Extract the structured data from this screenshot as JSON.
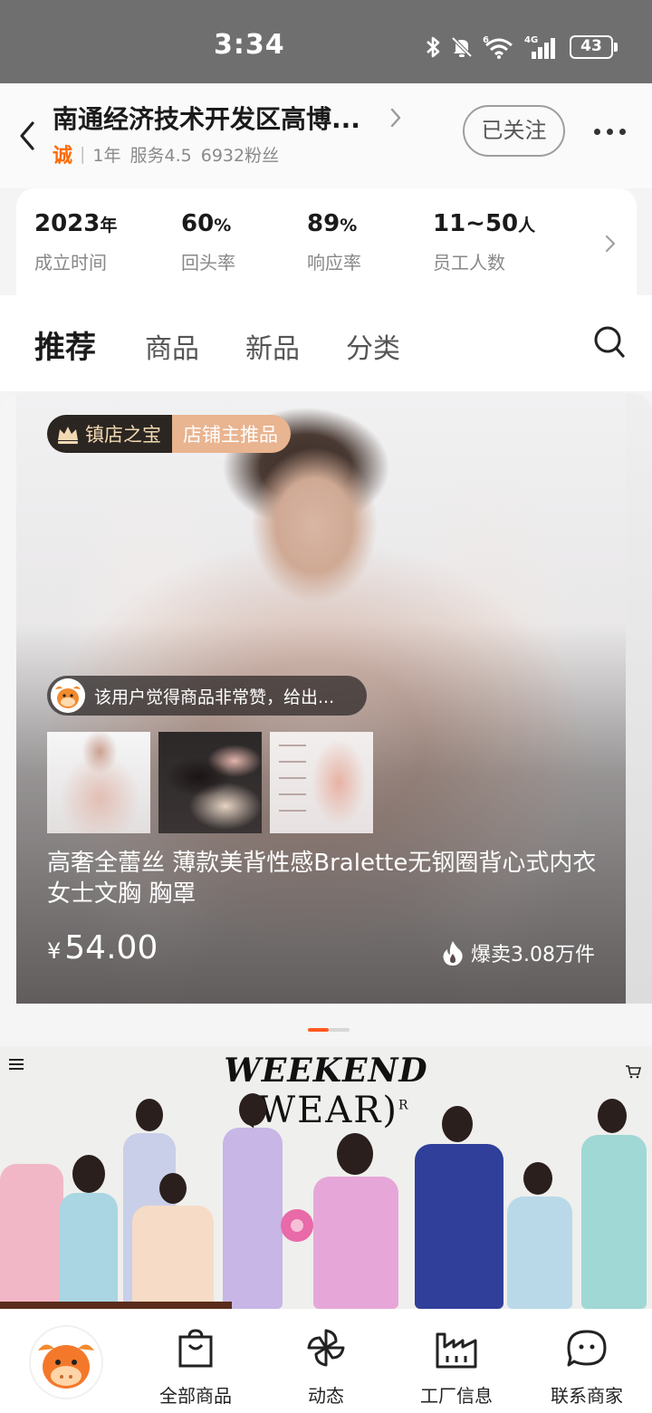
{
  "status_bar": {
    "time": "3:34",
    "battery": "43",
    "network": "4G"
  },
  "shop": {
    "name": "南通经济技术开发区高博...",
    "badge_icon_text": "诚",
    "years": "1年",
    "service": "服务4.5",
    "fans": "6932粉丝",
    "follow_label": "已关注"
  },
  "stats": [
    {
      "value": "2023",
      "unit": "年",
      "label": "成立时间"
    },
    {
      "value": "60",
      "unit": "%",
      "label": "回头率"
    },
    {
      "value": "89",
      "unit": "%",
      "label": "响应率"
    },
    {
      "value": "11~50",
      "unit": "人",
      "label": "员工人数"
    }
  ],
  "tabs": [
    {
      "label": "推荐",
      "active": true
    },
    {
      "label": "商品",
      "active": false
    },
    {
      "label": "新品",
      "active": false
    },
    {
      "label": "分类",
      "active": false
    }
  ],
  "featured": {
    "badge_left": "镇店之宝",
    "badge_right": "店铺主推品",
    "review": "该用户觉得商品非常赞，给出...",
    "title": "高奢全蕾丝 薄款美背性感Bralette无钢圈背心式内衣女士文胸 胸罩",
    "price_symbol": "¥",
    "price": "54.00",
    "sales": "爆卖3.08万件",
    "carousel_index": 1,
    "carousel_total": 2
  },
  "banner": {
    "title": "WEEKEND",
    "subtitle": "(WEAR)",
    "mark": "R"
  },
  "bottom_nav": [
    {
      "label": "全部商品",
      "icon": "shopping-bag-icon"
    },
    {
      "label": "动态",
      "icon": "pinwheel-icon"
    },
    {
      "label": "工厂信息",
      "icon": "factory-icon"
    },
    {
      "label": "联系商家",
      "icon": "chat-bubble-icon"
    }
  ],
  "colors": {
    "accent": "#ff5a1f",
    "cheng_orange": "#ff6a00",
    "badge_dark": "#2b2622",
    "badge_peach": "#e9b490",
    "status_bar": "#6f6f6f"
  }
}
